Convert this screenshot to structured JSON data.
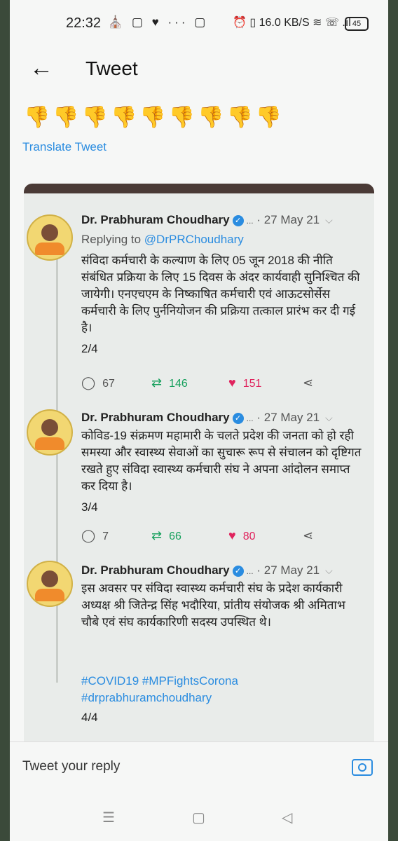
{
  "status_bar": {
    "time": "22:32",
    "left_icons": "⛪ ▢ ♥ ··· ▢",
    "right_icons": "⏰ ▯ 16.0 KB/S ≋ ☏ .ıl",
    "battery": "45"
  },
  "header": {
    "title": "Tweet"
  },
  "tweet_main": {
    "emojis": "👎👎👎👎👎👎👎👎👎",
    "translate": "Translate Tweet"
  },
  "thread": [
    {
      "author": "Dr. Prabhuram Choudhary",
      "dots": "...",
      "date": "· 27 May 21",
      "reply_to_prefix": "Replying to ",
      "reply_handle": "@DrPRChoudhary",
      "body": "संविदा कर्मचारी के कल्याण के लिए 05 जून 2018 की नीति संबंधित प्रक्रिया के लिए 15 दिवस के अंदर कार्यवाही सुनिश्चित की जायेगी। एनएचएम के निष्काषित कर्मचारी एवं आऊटसोर्सेस कर्मचारी के लिए पुर्ननियोजन की प्रक्रिया तत्काल प्रारंभ कर दी गई है।",
      "count": "2/4",
      "replies": "67",
      "retweets": "146",
      "likes": "151"
    },
    {
      "author": "Dr. Prabhuram Choudhary",
      "dots": "...",
      "date": "· 27 May 21",
      "body": "कोविड-19 संक्रमण महामारी के चलते प्रदेश की जनता को हो रही समस्या और स्वास्थ्य सेवाओं का सुचारू रूप से संचालन को दृष्टिगत रखते हुए संविदा स्वास्थ्य कर्मचारी संघ ने अपना आंदोलन समाप्त कर दिया है।",
      "count": "3/4",
      "replies": "7",
      "retweets": "66",
      "likes": "80"
    },
    {
      "author": "Dr. Prabhuram Choudhary",
      "dots": "...",
      "date": "· 27 May 21",
      "body": "इस अवसर पर संविदा स्वास्थ्य कर्मचारी संघ के प्रदेश कार्यकारी अध्यक्ष श्री जितेन्द्र सिंह भदौरिया, प्रांतीय संयोजक श्री अमिताभ चौबे एवं संघ कार्यकारिणी सदस्य उपस्थित थे।",
      "hashtags": "#COVID19 #MPFightsCorona #drprabhuramchoudhary",
      "count": "4/4"
    }
  ],
  "reply_bar": {
    "placeholder": "Tweet your reply"
  },
  "nav": {
    "menu": "☰",
    "home": "▢",
    "back": "◁"
  },
  "colors": {
    "link": "#2a8ce0",
    "retweet": "#17a05d",
    "like": "#e0245e"
  }
}
